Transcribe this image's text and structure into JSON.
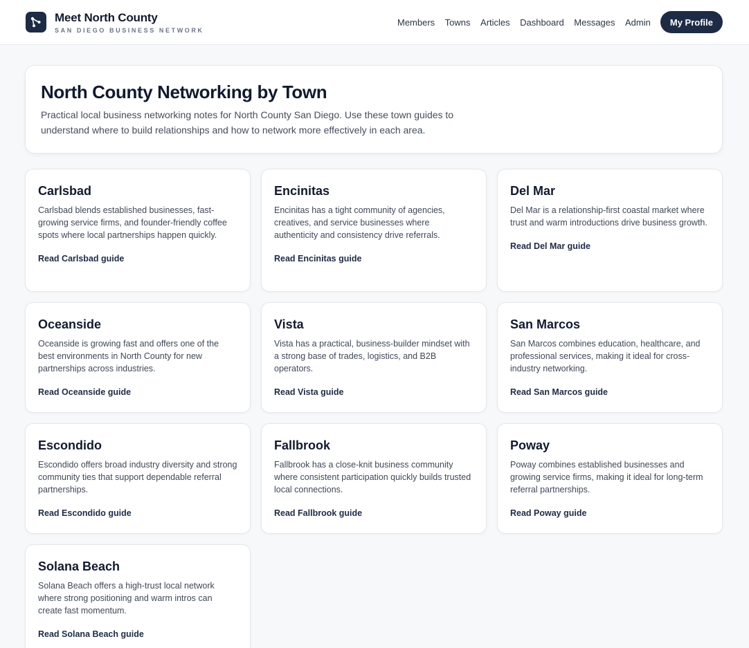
{
  "brand": {
    "title": "Meet North County",
    "subtitle": "SAN DIEGO BUSINESS NETWORK"
  },
  "nav": {
    "links": [
      "Members",
      "Towns",
      "Articles",
      "Dashboard",
      "Messages",
      "Admin"
    ],
    "profile_label": "My Profile"
  },
  "hero": {
    "title": "North County Networking by Town",
    "description": "Practical local business networking notes for North County San Diego. Use these town guides to understand where to build relationships and how to network more effectively in each area."
  },
  "towns": [
    {
      "name": "Carlsbad",
      "description": "Carlsbad blends established businesses, fast-growing service firms, and founder-friendly coffee spots where local partnerships happen quickly.",
      "link": "Read Carlsbad guide"
    },
    {
      "name": "Encinitas",
      "description": "Encinitas has a tight community of agencies, creatives, and service businesses where authenticity and consistency drive referrals.",
      "link": "Read Encinitas guide"
    },
    {
      "name": "Del Mar",
      "description": "Del Mar is a relationship-first coastal market where trust and warm introductions drive business growth.",
      "link": "Read Del Mar guide"
    },
    {
      "name": "Oceanside",
      "description": "Oceanside is growing fast and offers one of the best environments in North County for new partnerships across industries.",
      "link": "Read Oceanside guide"
    },
    {
      "name": "Vista",
      "description": "Vista has a practical, business-builder mindset with a strong base of trades, logistics, and B2B operators.",
      "link": "Read Vista guide"
    },
    {
      "name": "San Marcos",
      "description": "San Marcos combines education, healthcare, and professional services, making it ideal for cross-industry networking.",
      "link": "Read San Marcos guide"
    },
    {
      "name": "Escondido",
      "description": "Escondido offers broad industry diversity and strong community ties that support dependable referral partnerships.",
      "link": "Read Escondido guide"
    },
    {
      "name": "Fallbrook",
      "description": "Fallbrook has a close-knit business community where consistent participation quickly builds trusted local connections.",
      "link": "Read Fallbrook guide"
    },
    {
      "name": "Poway",
      "description": "Poway combines established businesses and growing service firms, making it ideal for long-term referral partnerships.",
      "link": "Read Poway guide"
    },
    {
      "name": "Solana Beach",
      "description": "Solana Beach offers a high-trust local network where strong positioning and warm intros can create fast momentum.",
      "link": "Read Solana Beach guide"
    }
  ],
  "icons": {
    "logo": "network-nodes-icon"
  },
  "colors": {
    "accent": "#1e2b45",
    "background": "#f7f8fa"
  }
}
